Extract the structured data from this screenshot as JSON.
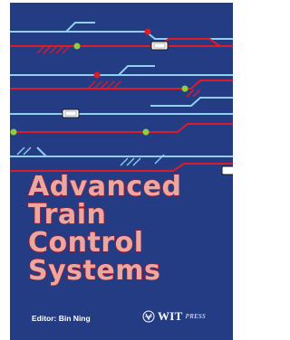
{
  "book": {
    "title_lines": [
      "Advanced",
      "Train",
      "Control",
      "Systems"
    ],
    "editor": "Editor: Bin Ning",
    "publisher": {
      "name": "WIT",
      "suffix": "PRESS",
      "logo_icon": "wit-crest-icon"
    }
  },
  "colors": {
    "background": "#233c84",
    "track_light": "#8fd0ee",
    "track_red": "#e01a27",
    "signal_green": "#8ecf3c",
    "title_fill": "#e9a9a3",
    "title_outline": "#b51626"
  }
}
